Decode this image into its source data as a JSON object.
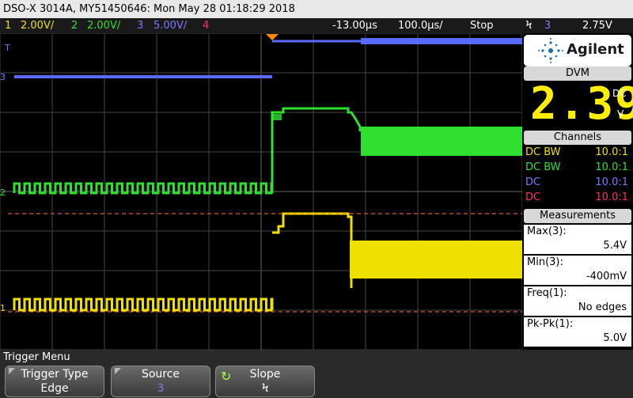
{
  "title_bar": "DSO-X 3014A, MY51450646: Mon May 28 01:18:29 2018",
  "status": {
    "ch1_num": "1",
    "ch1_scale": "2.00V/",
    "ch2_num": "2",
    "ch2_scale": "2.00V/",
    "ch3_num": "3",
    "ch3_scale": "5.00V/",
    "ch4_num": "4",
    "delay": "-13.00µs",
    "timebase": "100.0µs/",
    "run_state": "Stop",
    "trig_icon": "Ϟ",
    "trig_source": "3",
    "trig_level": "2.75V"
  },
  "logo": {
    "text": "Agilent"
  },
  "dvm": {
    "header": "DVM",
    "value": "2.39",
    "mode": "DC",
    "unit": "V"
  },
  "channels": {
    "header": "Channels",
    "rows": [
      {
        "coupling": "DC BW",
        "probe": "10.0:1",
        "color": "#f0e000"
      },
      {
        "coupling": "DC BW",
        "probe": "10.0:1",
        "color": "#30e030"
      },
      {
        "coupling": "DC",
        "probe": "10.0:1",
        "color": "#7a7aff"
      },
      {
        "coupling": "DC",
        "probe": "10.0:1",
        "color": "#ff3070"
      }
    ]
  },
  "measurements": {
    "header": "Measurements",
    "items": [
      {
        "label": "Max(3):",
        "value": "5.4V"
      },
      {
        "label": "Min(3):",
        "value": "-400mV"
      },
      {
        "label": "Freq(1):",
        "value": "No edges"
      },
      {
        "label": "Pk-Pk(1):",
        "value": "5.0V"
      }
    ]
  },
  "markers": {
    "ch3": "3",
    "ch2": "2",
    "ch1": "1",
    "trig": "T"
  },
  "menu": {
    "title": "Trigger Menu",
    "keys": [
      {
        "label": "Trigger Type",
        "value": "Edge"
      },
      {
        "label": "Source",
        "value": "3"
      },
      {
        "label": "Slope",
        "value": "Ϟ"
      }
    ]
  },
  "colors": {
    "ch1": "#f0e000",
    "ch2": "#30e030",
    "ch3": "#5a6aff",
    "ch4": "#ff3070"
  }
}
